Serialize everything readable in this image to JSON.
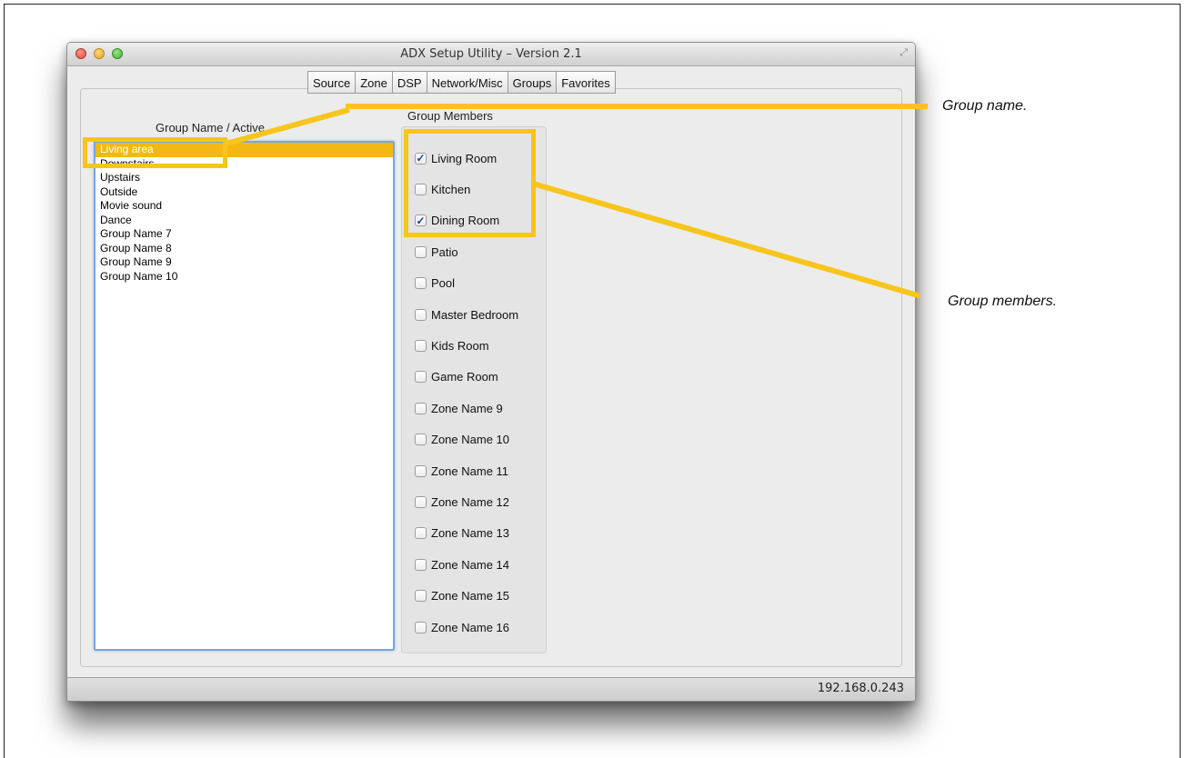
{
  "window": {
    "title": "ADX Setup Utility – Version 2.1",
    "fullscreen_glyph": "⤢"
  },
  "tabs": [
    {
      "label": "Source",
      "active": false
    },
    {
      "label": "Zone",
      "active": false
    },
    {
      "label": "DSP",
      "active": false
    },
    {
      "label": "Network/Misc",
      "active": false
    },
    {
      "label": "Groups",
      "active": true
    },
    {
      "label": "Favorites",
      "active": false
    }
  ],
  "groups": {
    "header": "Group Name / Active",
    "items": [
      "Living area",
      "Downstairs",
      "Upstairs",
      "Outside",
      "Movie sound",
      "Dance",
      "Group Name 7",
      "Group Name 8",
      "Group Name 9",
      "Group Name 10"
    ],
    "selected_index": 0
  },
  "members": {
    "header": "Group Members",
    "items": [
      {
        "label": "Living Room",
        "checked": true
      },
      {
        "label": "Kitchen",
        "checked": false
      },
      {
        "label": "Dining Room",
        "checked": true
      },
      {
        "label": "Patio",
        "checked": false
      },
      {
        "label": "Pool",
        "checked": false
      },
      {
        "label": "Master Bedroom",
        "checked": false
      },
      {
        "label": "Kids Room",
        "checked": false
      },
      {
        "label": "Game Room",
        "checked": false
      },
      {
        "label": "Zone Name 9",
        "checked": false
      },
      {
        "label": "Zone Name 10",
        "checked": false
      },
      {
        "label": "Zone Name 11",
        "checked": false
      },
      {
        "label": "Zone Name 12",
        "checked": false
      },
      {
        "label": "Zone Name 13",
        "checked": false
      },
      {
        "label": "Zone Name 14",
        "checked": false
      },
      {
        "label": "Zone Name 15",
        "checked": false
      },
      {
        "label": "Zone Name 16",
        "checked": false
      }
    ]
  },
  "status": {
    "ip": "192.168.0.243"
  },
  "annotations": {
    "group_name": "Group name.",
    "group_members": "Group members."
  },
  "colors": {
    "highlight": "#f7c51c",
    "selection": "#f4b814",
    "focus_ring": "#79a6de"
  }
}
